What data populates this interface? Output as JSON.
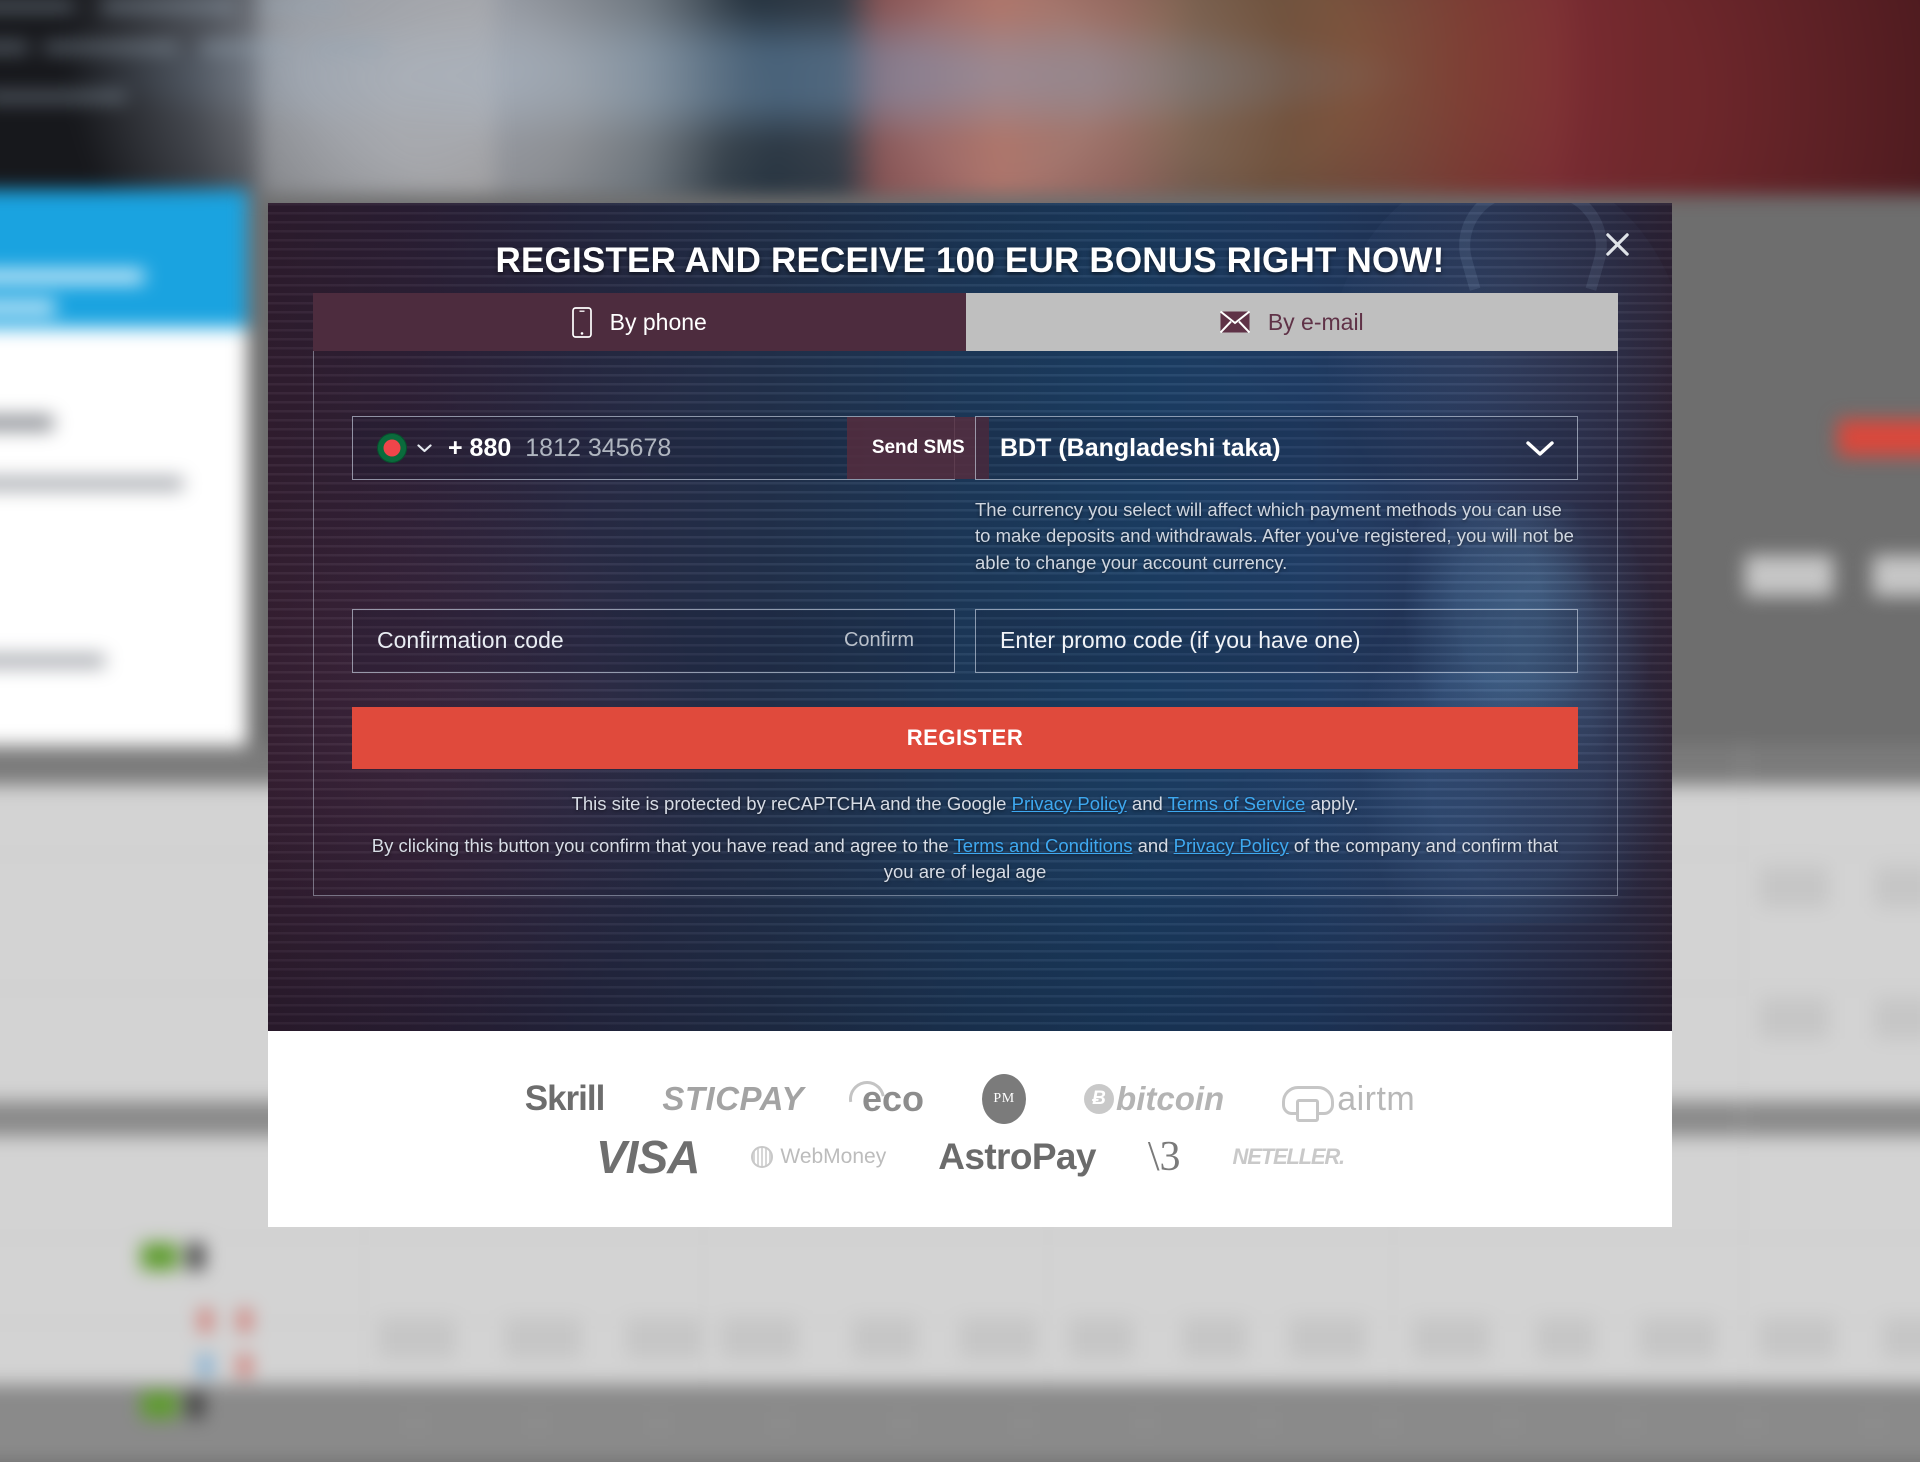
{
  "modal": {
    "title": "REGISTER AND RECEIVE 100 EUR BONUS RIGHT NOW!",
    "close_icon": "close-icon",
    "accent_color": "#e04a3c",
    "tab_active_color": "#4d2c3e",
    "tab_inactive_color": "#bfbfbf",
    "tabs": [
      {
        "label": "By phone",
        "icon": "phone-icon",
        "active": true
      },
      {
        "label": "By e-mail",
        "icon": "envelope-icon",
        "active": false
      }
    ],
    "form": {
      "phone": {
        "country_flag": "bangladesh-flag-icon",
        "dial_code": "+ 880",
        "value": "",
        "placeholder": "1812 345678",
        "send_sms_label": "Send SMS"
      },
      "currency": {
        "value": "BDT (Bangladeshi taka)",
        "caret_icon": "chevron-down-icon",
        "note": "The currency you select will affect which payment methods you can use to make deposits and withdrawals. After you've registered, you will not be able to change your account currency."
      },
      "confirmation": {
        "value": "",
        "placeholder": "Confirmation code",
        "confirm_label": "Confirm"
      },
      "promo": {
        "value": "",
        "placeholder": "Enter promo code (if you have one)"
      },
      "register_label": "REGISTER"
    },
    "legal": {
      "recaptcha": {
        "prefix": "This site is protected by reCAPTCHA and the Google ",
        "link1": "Privacy Policy",
        "mid": " and ",
        "link2": "Terms of Service",
        "suffix": " apply."
      },
      "terms": {
        "prefix": "By clicking this button you confirm that you have read and agree to the ",
        "link1": "Terms and Conditions",
        "mid": " and ",
        "link2": "Privacy Policy",
        "suffix": " of the company and confirm that you are of legal age"
      }
    }
  },
  "payments": {
    "row1": [
      {
        "name": "Skrill",
        "label": "Skrill"
      },
      {
        "name": "STICPAY",
        "label": "STICPAY"
      },
      {
        "name": "eco",
        "label": "eco"
      },
      {
        "name": "Perfect Money",
        "label": "PM"
      },
      {
        "name": "bitcoin",
        "label": "bitcoin",
        "mark": "Ƀ"
      },
      {
        "name": "airtm",
        "label": "airtm"
      }
    ],
    "row2": [
      {
        "name": "VISA",
        "label": "VISA"
      },
      {
        "name": "WebMoney",
        "label": "WebMoney"
      },
      {
        "name": "AstroPay",
        "label": "AstroPay"
      },
      {
        "name": "Beeline",
        "label": "\\3"
      },
      {
        "name": "NETELLER",
        "label": "NETELLER."
      }
    ]
  }
}
